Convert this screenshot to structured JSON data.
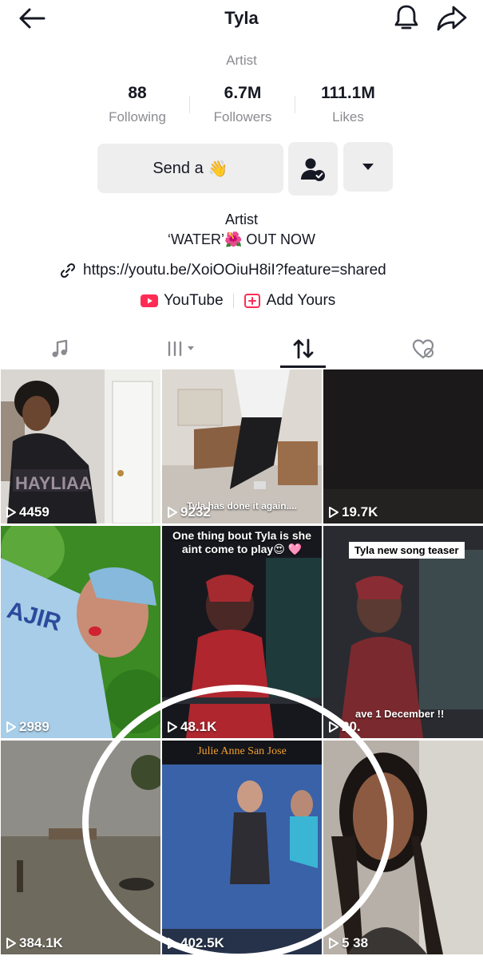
{
  "header": {
    "title": "Tyla",
    "profession": "Artist"
  },
  "stats": [
    {
      "value": "88",
      "label": "Following"
    },
    {
      "value": "6.7M",
      "label": "Followers"
    },
    {
      "value": "111.1M",
      "label": "Likes"
    }
  ],
  "actions": {
    "send_label": "Send a",
    "send_emoji": "👋"
  },
  "bio": {
    "line1": "Artist",
    "line2": "‘WATER’🌺 OUT NOW",
    "link": "https://youtu.be/XoiOOiuH8iI?feature=shared"
  },
  "chips": [
    {
      "label": "YouTube"
    },
    {
      "label": "Add Yours"
    }
  ],
  "tabs": [
    "music-icon",
    "bars-icon",
    "repost-icon",
    "liked-icon"
  ],
  "videos": [
    {
      "views": "4459",
      "bg": "#5c5552"
    },
    {
      "views": "9232",
      "bg": "#6d6560",
      "caption": "Tyla has done it again...."
    },
    {
      "views": "19.7K",
      "bg": "#1b1919"
    },
    {
      "views": "2989",
      "bg": "#3f8a26"
    },
    {
      "views": "48.1K",
      "bg": "#1a1c24",
      "caption": "One thing bout Tyla is she aint come to play😍 🩷"
    },
    {
      "views": "20.",
      "bg": "#2a2b31",
      "label": "Tyla new song teaser",
      "caption": "ave 1 December !!"
    },
    {
      "views": "384.1K",
      "bg": "#6b6862"
    },
    {
      "views": "402.5K",
      "bg": "#2f4f8a",
      "label": "Julie Anne San Jose"
    },
    {
      "views": "5 38",
      "bg": "#4a3a33"
    }
  ],
  "colors": {
    "accent": "#fe2c55",
    "text": "#161823",
    "muted": "#8a8b91"
  }
}
